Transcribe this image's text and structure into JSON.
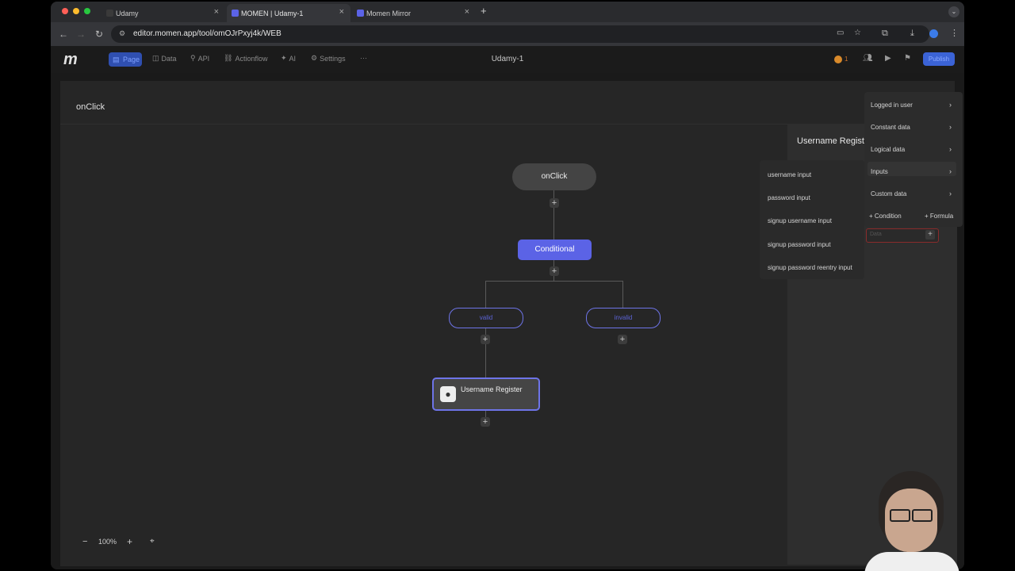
{
  "browser": {
    "tabs": [
      {
        "title": "Udamy",
        "active": false
      },
      {
        "title": "MOMEN | Udamy-1",
        "active": true
      },
      {
        "title": "Momen Mirror",
        "active": false
      }
    ],
    "url": "editor.momen.app/tool/omOJrPxyj4k/WEB"
  },
  "app": {
    "logo": "m",
    "nav": {
      "page": "Page",
      "data": "Data",
      "api": "API",
      "actionflow": "Actionflow",
      "ai": "AI",
      "settings": "Settings",
      "more": "···"
    },
    "project_name": "Udamy-1",
    "badge_count": "1",
    "publish_label": "Publish"
  },
  "canvas": {
    "title": "onClick",
    "root_node": "onClick",
    "conditional_node": "Conditional",
    "branch_valid": "valid",
    "branch_invalid": "invalid",
    "action_node": "Username Register",
    "zoom": "100%",
    "zoom_minus": "−",
    "zoom_plus": "+"
  },
  "panel": {
    "title": "Username Register"
  },
  "inputs_menu": {
    "items": [
      "username input",
      "password input",
      "signup username input",
      "signup password input",
      "signup password reentry input"
    ]
  },
  "data_menu": {
    "items": [
      "Logged in user",
      "Constant data",
      "Logical data",
      "Inputs",
      "Custom data"
    ],
    "add_condition": "+ Condition",
    "add_formula": "+ Formula",
    "field_placeholder": "Data"
  },
  "colors": {
    "accent": "#5b63e6",
    "node_gray": "#454545",
    "publish": "#3b63d6"
  }
}
